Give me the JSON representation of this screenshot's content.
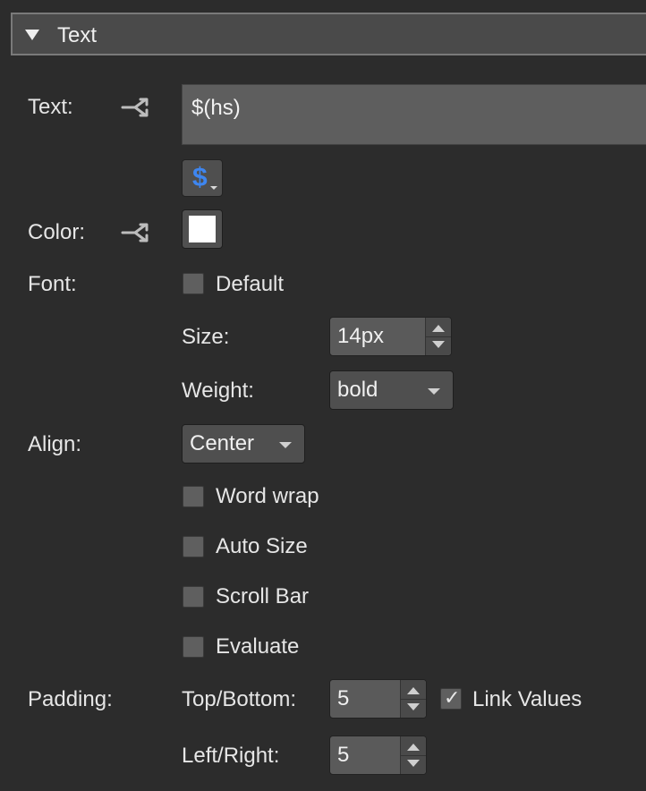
{
  "section": {
    "title": "Text",
    "expand_icon": "triangle-down-icon"
  },
  "text_row": {
    "label": "Text:",
    "value": "$(hs)",
    "link_icon": "link-branch-icon",
    "var_button": "$"
  },
  "color_row": {
    "label": "Color:",
    "link_icon": "link-branch-icon",
    "swatch_color": "#ffffff"
  },
  "font": {
    "label": "Font:",
    "default_label": "Default",
    "default_checked": false,
    "size_label": "Size:",
    "size_value": "14px",
    "weight_label": "Weight:",
    "weight_value": "bold"
  },
  "align": {
    "label": "Align:",
    "value": "Center",
    "options": [
      {
        "label": "Word wrap",
        "checked": false
      },
      {
        "label": "Auto Size",
        "checked": false
      },
      {
        "label": "Scroll Bar",
        "checked": false
      },
      {
        "label": "Evaluate",
        "checked": false
      }
    ]
  },
  "padding": {
    "label": "Padding:",
    "top_bottom_label": "Top/Bottom:",
    "top_bottom_value": "5",
    "left_right_label": "Left/Right:",
    "left_right_value": "5",
    "link_values_label": "Link Values",
    "link_values_checked": true
  }
}
